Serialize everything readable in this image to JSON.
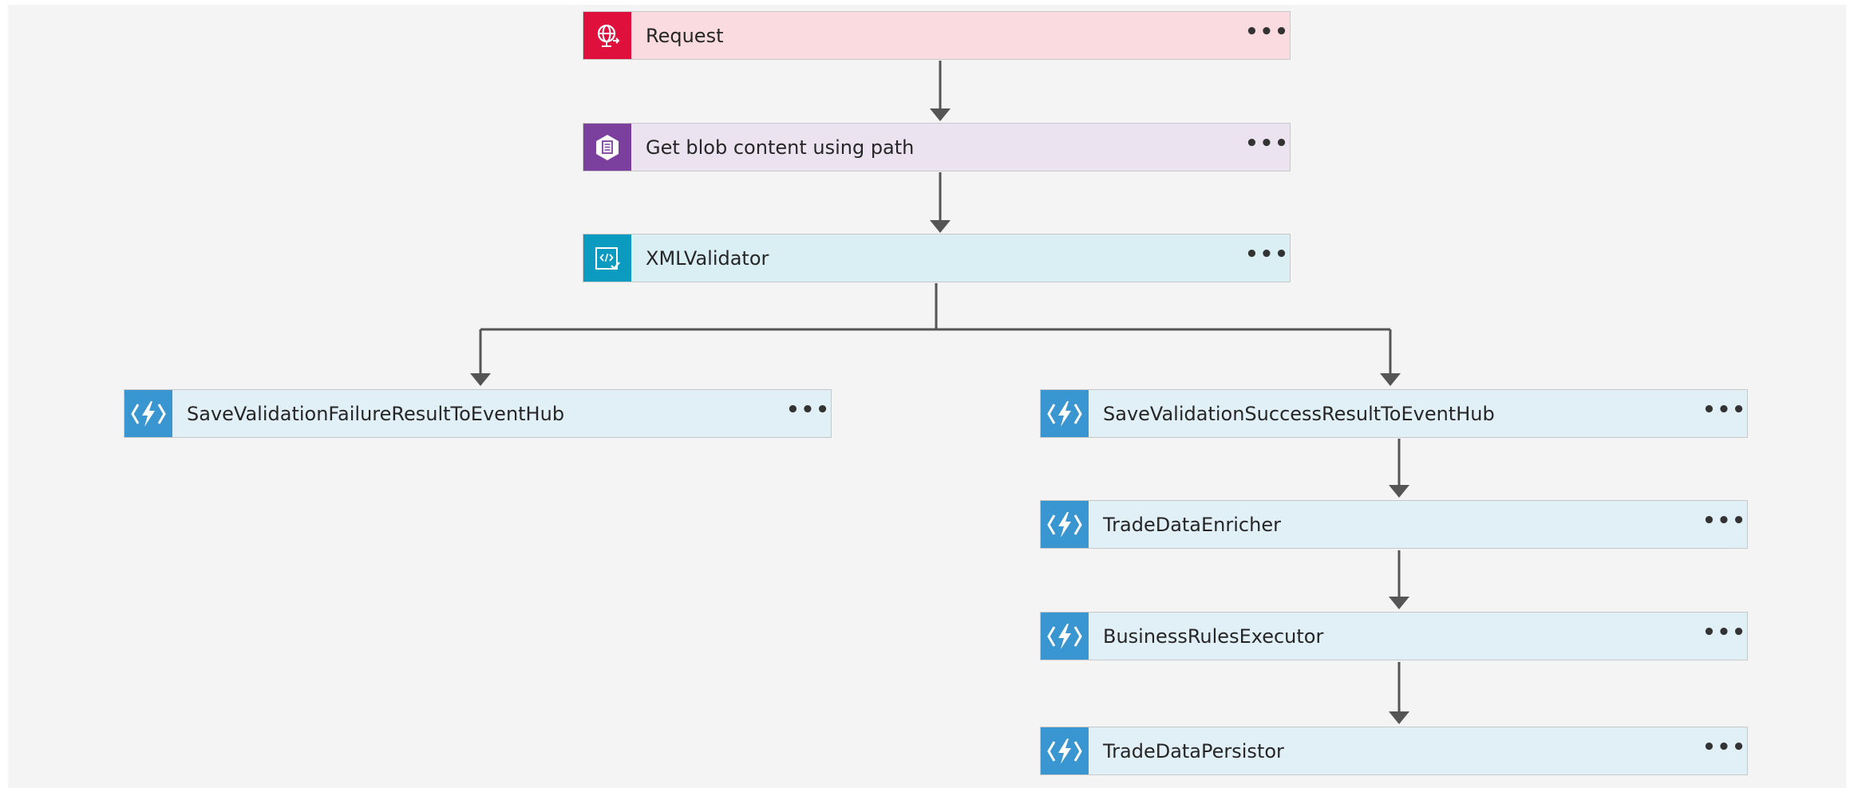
{
  "colors": {
    "request_accent": "#e0103d",
    "blob_accent": "#7b3f9e",
    "validator_accent": "#0b9bc1",
    "function_accent": "#3a96d0",
    "connector": "#555555"
  },
  "steps": {
    "request": {
      "label": "Request",
      "icon": "globe-request-icon",
      "more": "•••"
    },
    "get_blob": {
      "label": "Get blob content using path",
      "icon": "blob-storage-icon",
      "more": "•••"
    },
    "xml_validator": {
      "label": "XMLValidator",
      "icon": "xml-validate-icon",
      "more": "•••"
    },
    "save_failure": {
      "label": "SaveValidationFailureResultToEventHub",
      "icon": "azure-function-icon",
      "more": "•••"
    },
    "save_success": {
      "label": "SaveValidationSuccessResultToEventHub",
      "icon": "azure-function-icon",
      "more": "•••"
    },
    "enricher": {
      "label": "TradeDataEnricher",
      "icon": "azure-function-icon",
      "more": "•••"
    },
    "rules": {
      "label": "BusinessRulesExecutor",
      "icon": "azure-function-icon",
      "more": "•••"
    },
    "persistor": {
      "label": "TradeDataPersistor",
      "icon": "azure-function-icon",
      "more": "•••"
    }
  }
}
